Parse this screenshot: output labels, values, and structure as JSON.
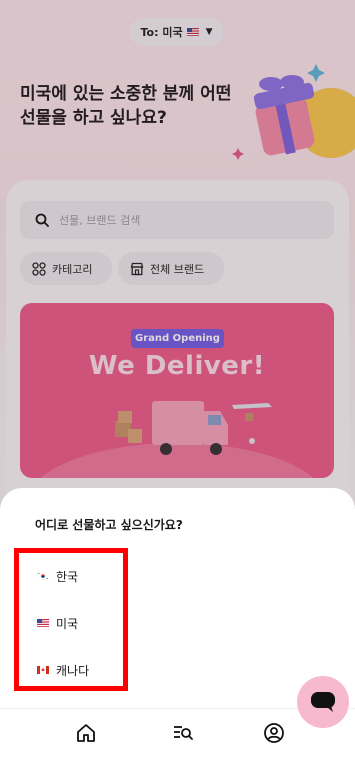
{
  "header": {
    "country_selector": "To: 미국",
    "country_flag": "us-flag-icon"
  },
  "hero": {
    "title": "미국에 있는 소중한 분께 어떤 선물을 하고 싶나요?"
  },
  "search": {
    "placeholder": "선물, 브랜드 검색"
  },
  "chips": {
    "category": "카테고리",
    "brands": "전체 브랜드"
  },
  "banner": {
    "badge": "Grand Opening",
    "title": "We Deliver!"
  },
  "sheet": {
    "title": "어디로 선물하고 싶으신가요?",
    "options": [
      {
        "label": "한국",
        "flag": "kr-flag-icon"
      },
      {
        "label": "미국",
        "flag": "us-flag-icon"
      },
      {
        "label": "캐나다",
        "flag": "ca-flag-icon"
      }
    ]
  },
  "nav": {
    "items": [
      "home-icon",
      "search-list-icon",
      "profile-icon"
    ]
  },
  "colors": {
    "accent_pink": "#ec5d8a",
    "badge_purple": "#6f5fe4",
    "highlight_red": "#ff0000",
    "chat_pink": "#f6b9cd"
  }
}
